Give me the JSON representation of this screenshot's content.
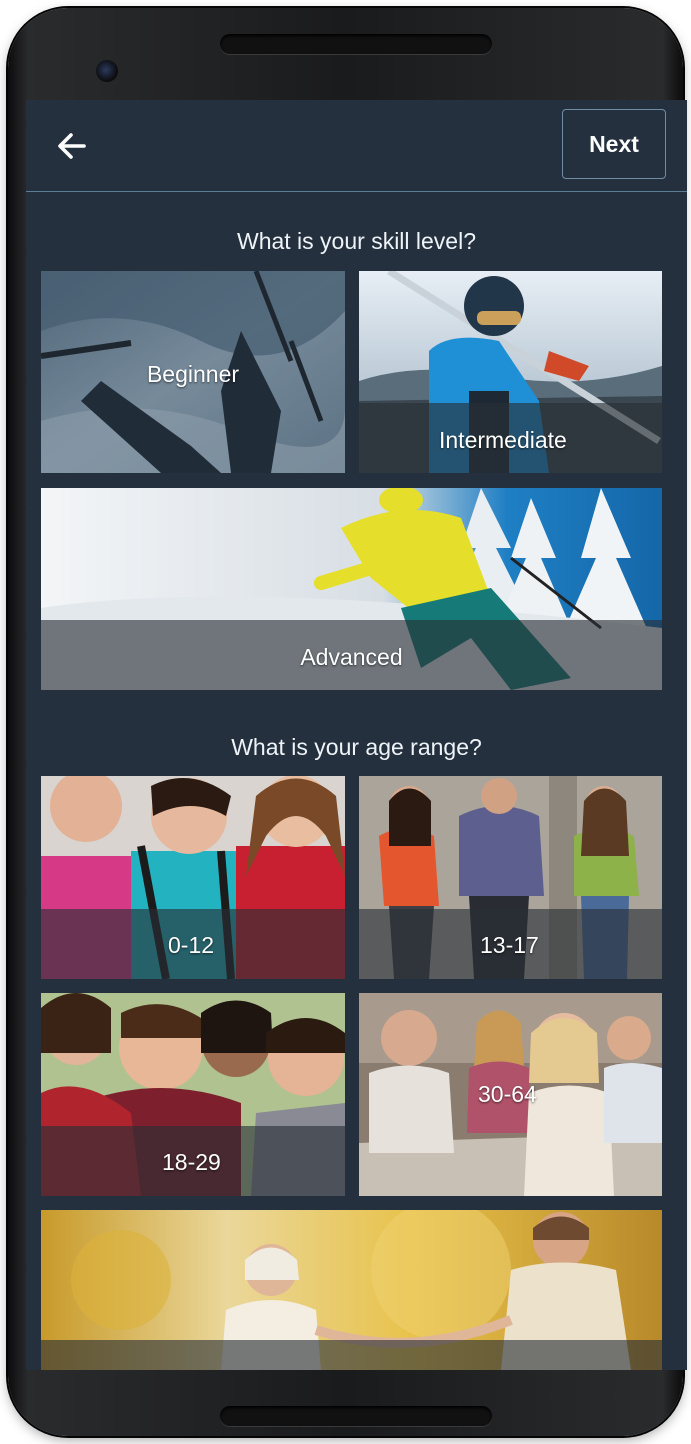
{
  "header": {
    "next_label": "Next"
  },
  "skill": {
    "title": "What is your skill level?",
    "options": [
      {
        "label": "Beginner"
      },
      {
        "label": "Intermediate"
      },
      {
        "label": "Advanced"
      }
    ]
  },
  "age": {
    "title": "What is your age range?",
    "options": [
      {
        "label": "0-12"
      },
      {
        "label": "13-17"
      },
      {
        "label": "18-29"
      },
      {
        "label": "30-64"
      },
      {
        "label": ""
      }
    ]
  },
  "colors": {
    "screen_bg": "#24303d",
    "accent_border": "#6f8ea6"
  },
  "icons": {
    "back": "arrow-left-icon",
    "camera": "front-camera-icon"
  }
}
